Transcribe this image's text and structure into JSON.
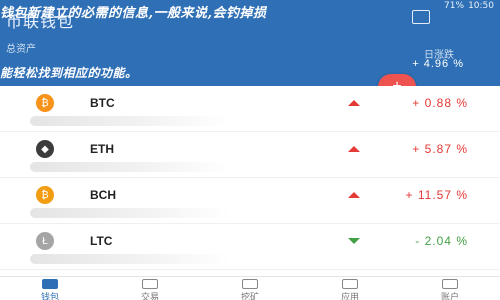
{
  "status_bar": {
    "battery": "71%",
    "time": "10:50"
  },
  "header": {
    "wallet_title": "币联钱包",
    "total_label": "总资产",
    "change_label": "日涨跌",
    "change_value": "+ 4.96 %",
    "overlay_line_1": "钱包新建立的必需的信息,一般来说,会钓掉损",
    "overlay_line_2": "能轻松找到相应的功能。"
  },
  "add_button": {
    "label": "+"
  },
  "coins": [
    {
      "name": "BTC",
      "icon": "bitcoin-icon",
      "icon_color": "#f7931a",
      "icon_glyph": "₿",
      "change": "+ 0.88 %",
      "direction": "up"
    },
    {
      "name": "ETH",
      "icon": "ethereum-icon",
      "icon_color": "#3c3c3d",
      "icon_glyph": "◆",
      "change": "+ 5.87 %",
      "direction": "up"
    },
    {
      "name": "BCH",
      "icon": "bitcoin-cash-icon",
      "icon_color": "#f39c12",
      "icon_glyph": "₿",
      "change": "+ 11.57 %",
      "direction": "up"
    },
    {
      "name": "LTC",
      "icon": "litecoin-icon",
      "icon_color": "#a5a5a5",
      "icon_glyph": "Ł",
      "change": "- 2.04 %",
      "direction": "down"
    }
  ],
  "tabs": [
    {
      "label": "钱包",
      "icon": "wallet-icon",
      "active": true
    },
    {
      "label": "交易",
      "icon": "exchange-icon",
      "active": false
    },
    {
      "label": "挖矿",
      "icon": "mining-icon",
      "active": false
    },
    {
      "label": "应用",
      "icon": "apps-icon",
      "active": false
    },
    {
      "label": "账户",
      "icon": "account-icon",
      "active": false
    }
  ],
  "colors": {
    "header_bg": "#2f6fb5",
    "accent_red": "#ef5350",
    "up": "#e53935",
    "down": "#43a047"
  }
}
